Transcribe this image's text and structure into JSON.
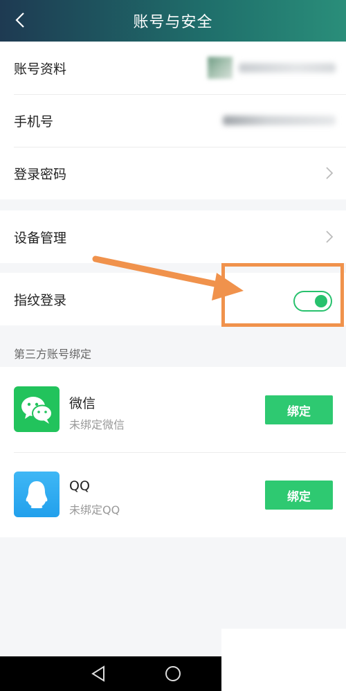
{
  "header": {
    "title": "账号与安全"
  },
  "account": {
    "profile_label": "账号资料",
    "phone_label": "手机号",
    "password_label": "登录密码"
  },
  "device": {
    "label": "设备管理"
  },
  "fingerprint": {
    "label": "指纹登录",
    "enabled": true
  },
  "third_party": {
    "caption": "第三方账号绑定",
    "items": [
      {
        "name": "微信",
        "status": "未绑定微信",
        "button": "绑定",
        "icon": "wechat-icon"
      },
      {
        "name": "QQ",
        "status": "未绑定QQ",
        "button": "绑定",
        "icon": "qq-icon"
      }
    ]
  },
  "colors": {
    "accent": "#2ec971",
    "annotation": "#f0924c",
    "header_start": "#1e3a52",
    "header_end": "#2a8e7a"
  }
}
